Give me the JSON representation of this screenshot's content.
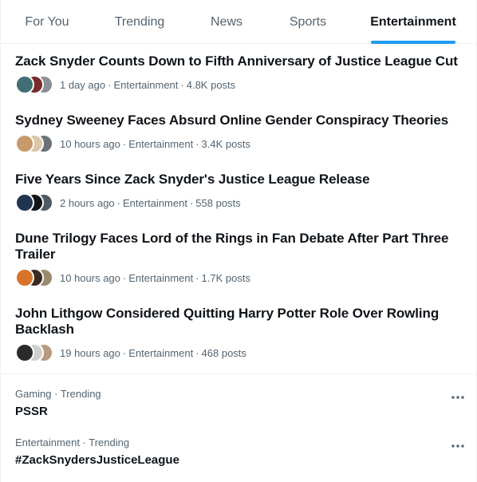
{
  "tabs": [
    {
      "label": "For You",
      "active": false
    },
    {
      "label": "Trending",
      "active": false
    },
    {
      "label": "News",
      "active": false
    },
    {
      "label": "Sports",
      "active": false
    },
    {
      "label": "Entertainment",
      "active": true
    }
  ],
  "news": [
    {
      "title": "Zack Snyder Counts Down to Fifth Anniversary of Justice League Cut",
      "time": "1 day ago",
      "category": "Entertainment",
      "posts": "4.8K posts",
      "avatar_colors": [
        "#3f6f74",
        "#7a2b2b",
        "#8a8f96"
      ]
    },
    {
      "title": "Sydney Sweeney Faces Absurd Online Gender Conspiracy Theories",
      "time": "10 hours ago",
      "category": "Entertainment",
      "posts": "3.4K posts",
      "avatar_colors": [
        "#c79a6a",
        "#d9c7a8",
        "#6d7278"
      ]
    },
    {
      "title": "Five Years Since Zack Snyder's Justice League Release",
      "time": "2 hours ago",
      "category": "Entertainment",
      "posts": "558 posts",
      "avatar_colors": [
        "#1f3550",
        "#111418",
        "#4e5a66"
      ]
    },
    {
      "title": "Dune Trilogy Faces Lord of the Rings in Fan Debate After Part Three Trailer",
      "time": "10 hours ago",
      "category": "Entertainment",
      "posts": "1.7K posts",
      "avatar_colors": [
        "#d8742a",
        "#3a2a22",
        "#9b8a6e"
      ]
    },
    {
      "title": "John Lithgow Considered Quitting Harry Potter Role Over Rowling Backlash",
      "time": "19 hours ago",
      "category": "Entertainment",
      "posts": "468 posts",
      "avatar_colors": [
        "#2a2a2a",
        "#cfcfcf",
        "#b89a80"
      ]
    }
  ],
  "trends": [
    {
      "context": "Gaming · Trending",
      "name": "PSSR"
    },
    {
      "context": "Entertainment · Trending",
      "name": "#ZackSnydersJusticeLeague"
    }
  ],
  "colors": {
    "accent": "#1d9bf0",
    "primary_text": "#0f1419",
    "secondary_text": "#536471",
    "border": "#eff3f4"
  },
  "icons": {
    "more": "more-horizontal-icon"
  }
}
